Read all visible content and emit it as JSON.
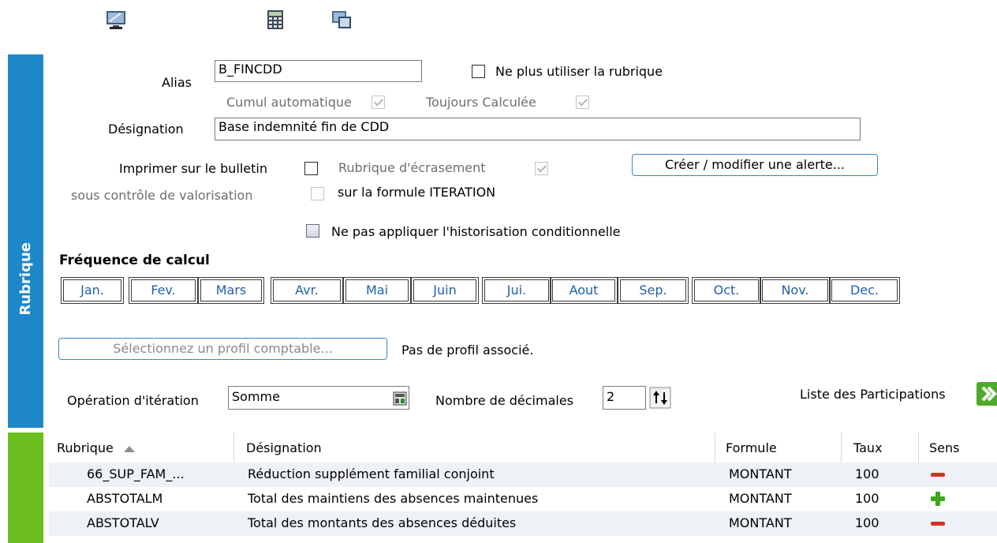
{
  "sidebar": {
    "label": "Rubrique"
  },
  "form": {
    "alias_label": "Alias",
    "alias_value": "B_FINCDD",
    "ne_plus_utiliser_label": "Ne plus utiliser la rubrique",
    "cumul_auto_label": "Cumul automatique",
    "toujours_calculee_label": "Toujours Calculée",
    "designation_label": "Désignation",
    "designation_value": "Base indemnité fin de CDD",
    "imprimer_label": "Imprimer sur le bulletin",
    "sous_controle_label": "sous contrôle de valorisation",
    "rubrique_ecrasement_label": "Rubrique d'écrasement",
    "formule_iteration_label": "sur la formule ITERATION",
    "creer_alerte_button": "Créer / modifier une alerte...",
    "historisation_label": "Ne pas appliquer l'historisation conditionnelle",
    "frequence_title": "Fréquence de calcul",
    "months": [
      "Jan.",
      "Fev.",
      "Mars",
      "Avr.",
      "Mai",
      "Juin",
      "Jui.",
      "Aout",
      "Sep.",
      "Oct.",
      "Nov.",
      "Dec."
    ],
    "profil_button": "Sélectionnez un profil comptable...",
    "profil_status": "Pas de profil associé.",
    "operation_label": "Opération d'itération",
    "operation_value": "Somme",
    "decimales_label": "Nombre de décimales",
    "decimales_value": "2",
    "liste_participations": "Liste des Participations"
  },
  "grid": {
    "columns": [
      "Rubrique",
      "Désignation",
      "Formule",
      "Taux",
      "Sens"
    ],
    "rows": [
      {
        "rubrique": "66_SUP_FAM_...",
        "designation": "Réduction supplément familial conjoint",
        "formule": "MONTANT",
        "taux": "100",
        "sens": "minus"
      },
      {
        "rubrique": "ABSTOTALM",
        "designation": "Total des maintiens des absences maintenues",
        "formule": "MONTANT",
        "taux": "100",
        "sens": "plus"
      },
      {
        "rubrique": "ABSTOTALV",
        "designation": "Total des montants des absences déduites",
        "formule": "MONTANT",
        "taux": "100",
        "sens": "minus"
      }
    ]
  },
  "colors": {
    "sidebar_blue": "#1e87c8",
    "sidebar_green": "#6cbf1e",
    "minus": "#d9301e",
    "plus": "#3ea51d",
    "link_blue": "#1f5fa8"
  },
  "icons": [
    "monitor-icon",
    "calculator-icon",
    "window-icon",
    "arrow-right-icon"
  ]
}
